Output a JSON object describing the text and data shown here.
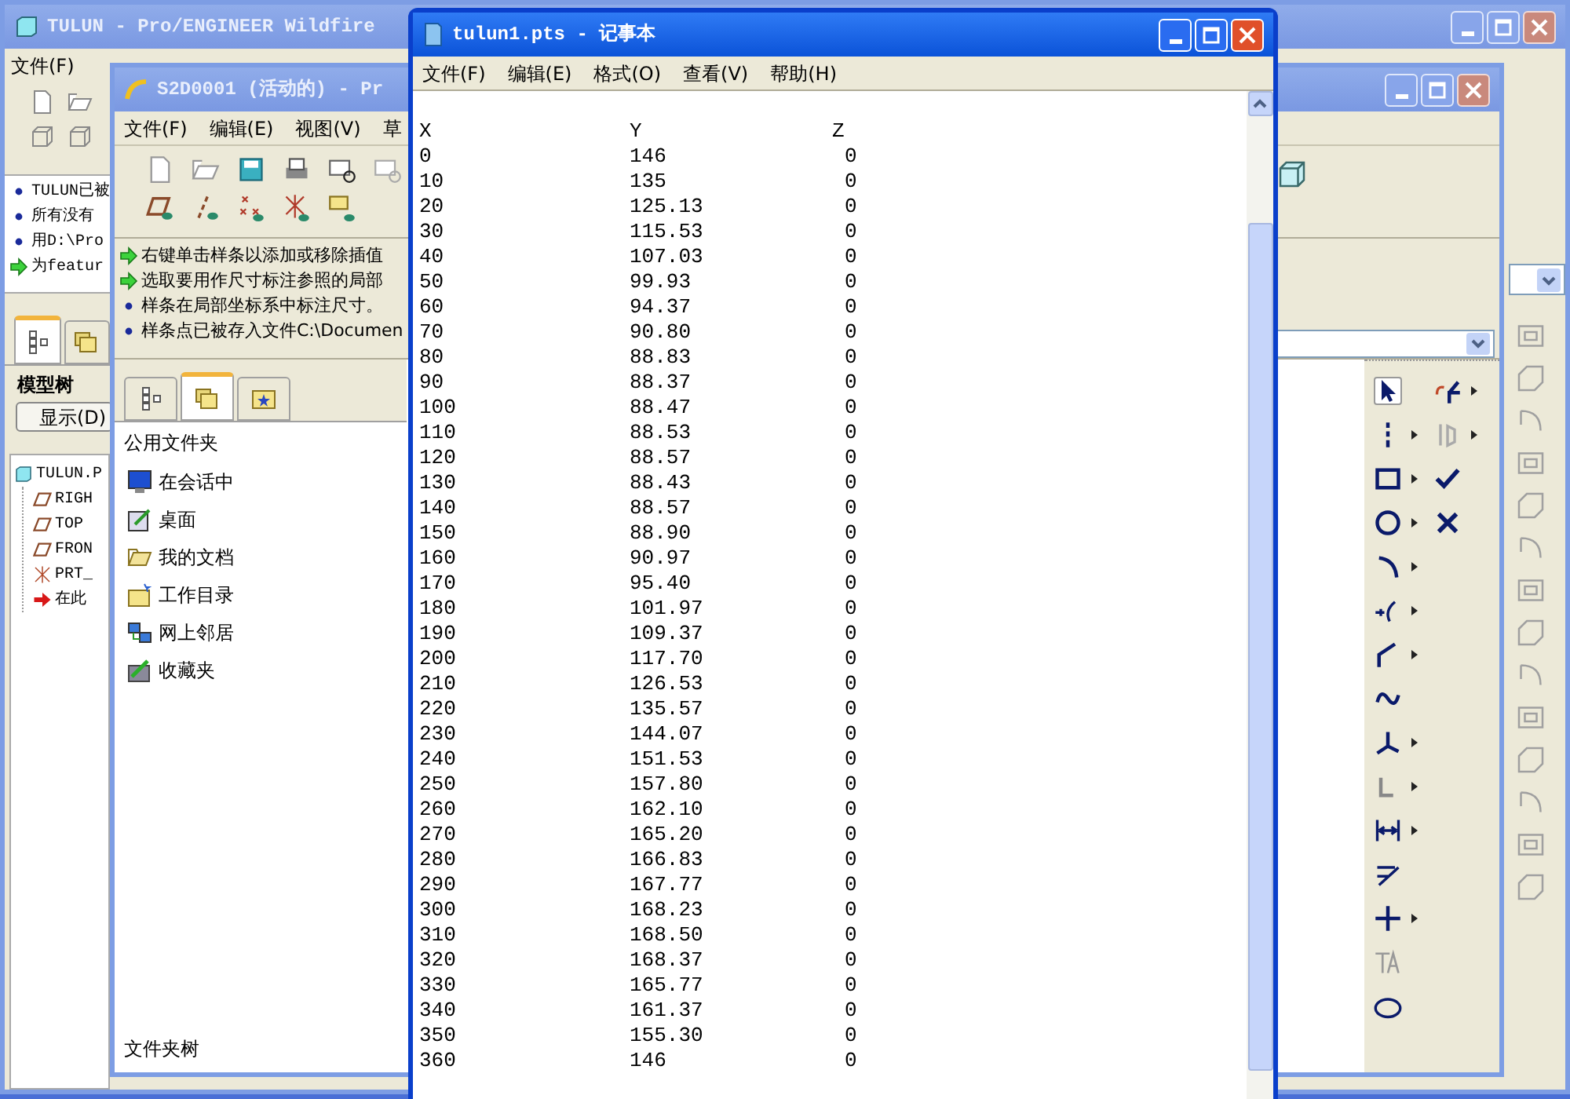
{
  "background_window": {
    "title": "TULUN - Pro/ENGINEER Wildfire",
    "menu": [
      "文件(F)"
    ],
    "messages": [
      {
        "kind": "info",
        "text": "TULUN已被"
      },
      {
        "kind": "info",
        "text": "所有没有"
      },
      {
        "kind": "info",
        "text": "用D:\\Pro"
      },
      {
        "kind": "prompt",
        "text": "为featur"
      }
    ],
    "tabs": [
      {
        "kind": "tree",
        "selected": true
      },
      {
        "kind": "folders",
        "selected": false
      }
    ],
    "panel_title": "模型树",
    "show_button": "显示(D)",
    "tree": [
      {
        "label": "TULUN.P",
        "kind": "part",
        "children": [
          {
            "label": "RIGH",
            "kind": "plane"
          },
          {
            "label": "TOP",
            "kind": "plane"
          },
          {
            "label": "FRON",
            "kind": "plane"
          },
          {
            "label": "PRT_",
            "kind": "csys"
          },
          {
            "label": "在此",
            "kind": "insert"
          }
        ]
      }
    ]
  },
  "sketch_window": {
    "title": "S2D0001 (活动的) - Pr",
    "menu": [
      "文件(F)",
      "编辑(E)",
      "视图(V)",
      "草"
    ],
    "messages": [
      {
        "kind": "prompt",
        "text": "右键单击样条以添加或移除插值"
      },
      {
        "kind": "prompt",
        "text": "选取要用作尺寸标注参照的局部"
      },
      {
        "kind": "info",
        "text": "样条在局部坐标系中标注尺寸。"
      },
      {
        "kind": "info",
        "text": "样条点已被存入文件C:\\Documen"
      }
    ],
    "tabs": [
      {
        "kind": "tree",
        "selected": false
      },
      {
        "kind": "folders",
        "selected": true
      },
      {
        "kind": "favorites",
        "selected": false
      }
    ],
    "folder_heading": "公用文件夹",
    "folders": [
      {
        "label": "在会话中",
        "kind": "session"
      },
      {
        "label": "桌面",
        "kind": "desktop"
      },
      {
        "label": "我的文档",
        "kind": "documents"
      },
      {
        "label": "工作目录",
        "kind": "workdir"
      },
      {
        "label": "网上邻居",
        "kind": "network"
      },
      {
        "label": "收藏夹",
        "kind": "favorites"
      }
    ],
    "footer": "文件夹树"
  },
  "notepad": {
    "title": "tulun1.pts - 记事本",
    "menu": [
      "文件(F)",
      "编辑(E)",
      "格式(O)",
      "查看(V)",
      "帮助(H)"
    ],
    "header": [
      "X",
      "Y",
      "Z"
    ],
    "rows": [
      [
        "0",
        "146",
        "0"
      ],
      [
        "10",
        "135",
        "0"
      ],
      [
        "20",
        "125.13",
        "0"
      ],
      [
        "30",
        "115.53",
        "0"
      ],
      [
        "40",
        "107.03",
        "0"
      ],
      [
        "50",
        "99.93",
        "0"
      ],
      [
        "60",
        "94.37",
        "0"
      ],
      [
        "70",
        "90.80",
        "0"
      ],
      [
        "80",
        "88.83",
        "0"
      ],
      [
        "90",
        "88.37",
        "0"
      ],
      [
        "100",
        "88.47",
        "0"
      ],
      [
        "110",
        "88.53",
        "0"
      ],
      [
        "120",
        "88.57",
        "0"
      ],
      [
        "130",
        "88.43",
        "0"
      ],
      [
        "140",
        "88.57",
        "0"
      ],
      [
        "150",
        "88.90",
        "0"
      ],
      [
        "160",
        "90.97",
        "0"
      ],
      [
        "170",
        "95.40",
        "0"
      ],
      [
        "180",
        "101.97",
        "0"
      ],
      [
        "190",
        "109.37",
        "0"
      ],
      [
        "200",
        "117.70",
        "0"
      ],
      [
        "210",
        "126.53",
        "0"
      ],
      [
        "220",
        "135.57",
        "0"
      ],
      [
        "230",
        "144.07",
        "0"
      ],
      [
        "240",
        "151.53",
        "0"
      ],
      [
        "250",
        "157.80",
        "0"
      ],
      [
        "260",
        "162.10",
        "0"
      ],
      [
        "270",
        "165.20",
        "0"
      ],
      [
        "280",
        "166.83",
        "0"
      ],
      [
        "290",
        "167.77",
        "0"
      ],
      [
        "300",
        "168.23",
        "0"
      ],
      [
        "310",
        "168.50",
        "0"
      ],
      [
        "320",
        "168.37",
        "0"
      ],
      [
        "330",
        "165.77",
        "0"
      ],
      [
        "340",
        "161.37",
        "0"
      ],
      [
        "350",
        "155.30",
        "0"
      ],
      [
        "360",
        "146",
        "0"
      ]
    ]
  }
}
